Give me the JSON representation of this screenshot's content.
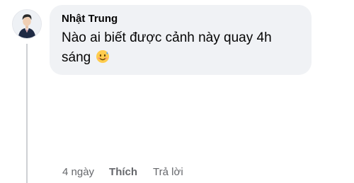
{
  "comment": {
    "author": "Nhật Trung",
    "text": "Nào ai biết được cảnh này quay 4h sáng",
    "emoji": "sweat-smile-emoji",
    "time": "4 ngày",
    "like_label": "Thích",
    "reply_label": "Trả lời",
    "avatar_icon": "profile-avatar"
  },
  "colors": {
    "bubble_bg": "#f0f2f5",
    "author_text": "#050505",
    "meta_text": "#65676b",
    "thread_line": "#ced0d4"
  }
}
